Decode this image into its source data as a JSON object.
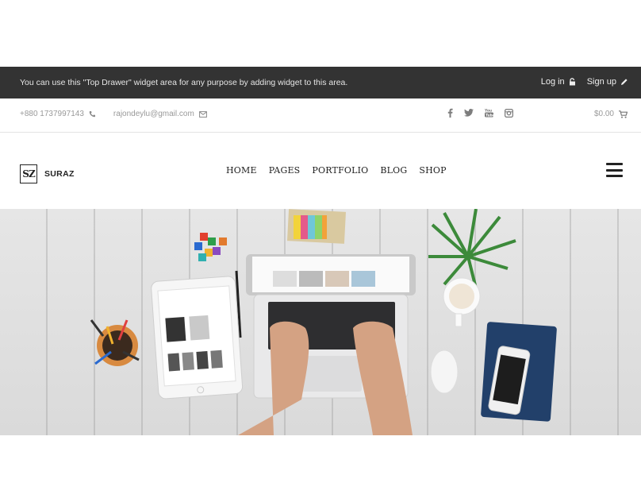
{
  "top_drawer": {
    "message": "You can use this \"Top Drawer\" widget area for any purpose by adding widget to this area.",
    "login_label": "Log in",
    "signup_label": "Sign up"
  },
  "contact": {
    "phone": "+880 1737997143",
    "email": "rajondeylu@gmail.com"
  },
  "social": [
    "facebook-icon",
    "twitter-icon",
    "youtube-icon",
    "instagram-icon"
  ],
  "cart": {
    "total": "$0.00"
  },
  "brand": {
    "mark": "SZ",
    "name": "SURAZ"
  },
  "nav": {
    "items": [
      "HOME",
      "PAGES",
      "PORTFOLIO",
      "BLOG",
      "SHOP"
    ]
  },
  "colors": {
    "top_drawer_bg": "#333333",
    "text_dark": "#222222",
    "text_muted": "#999999"
  }
}
